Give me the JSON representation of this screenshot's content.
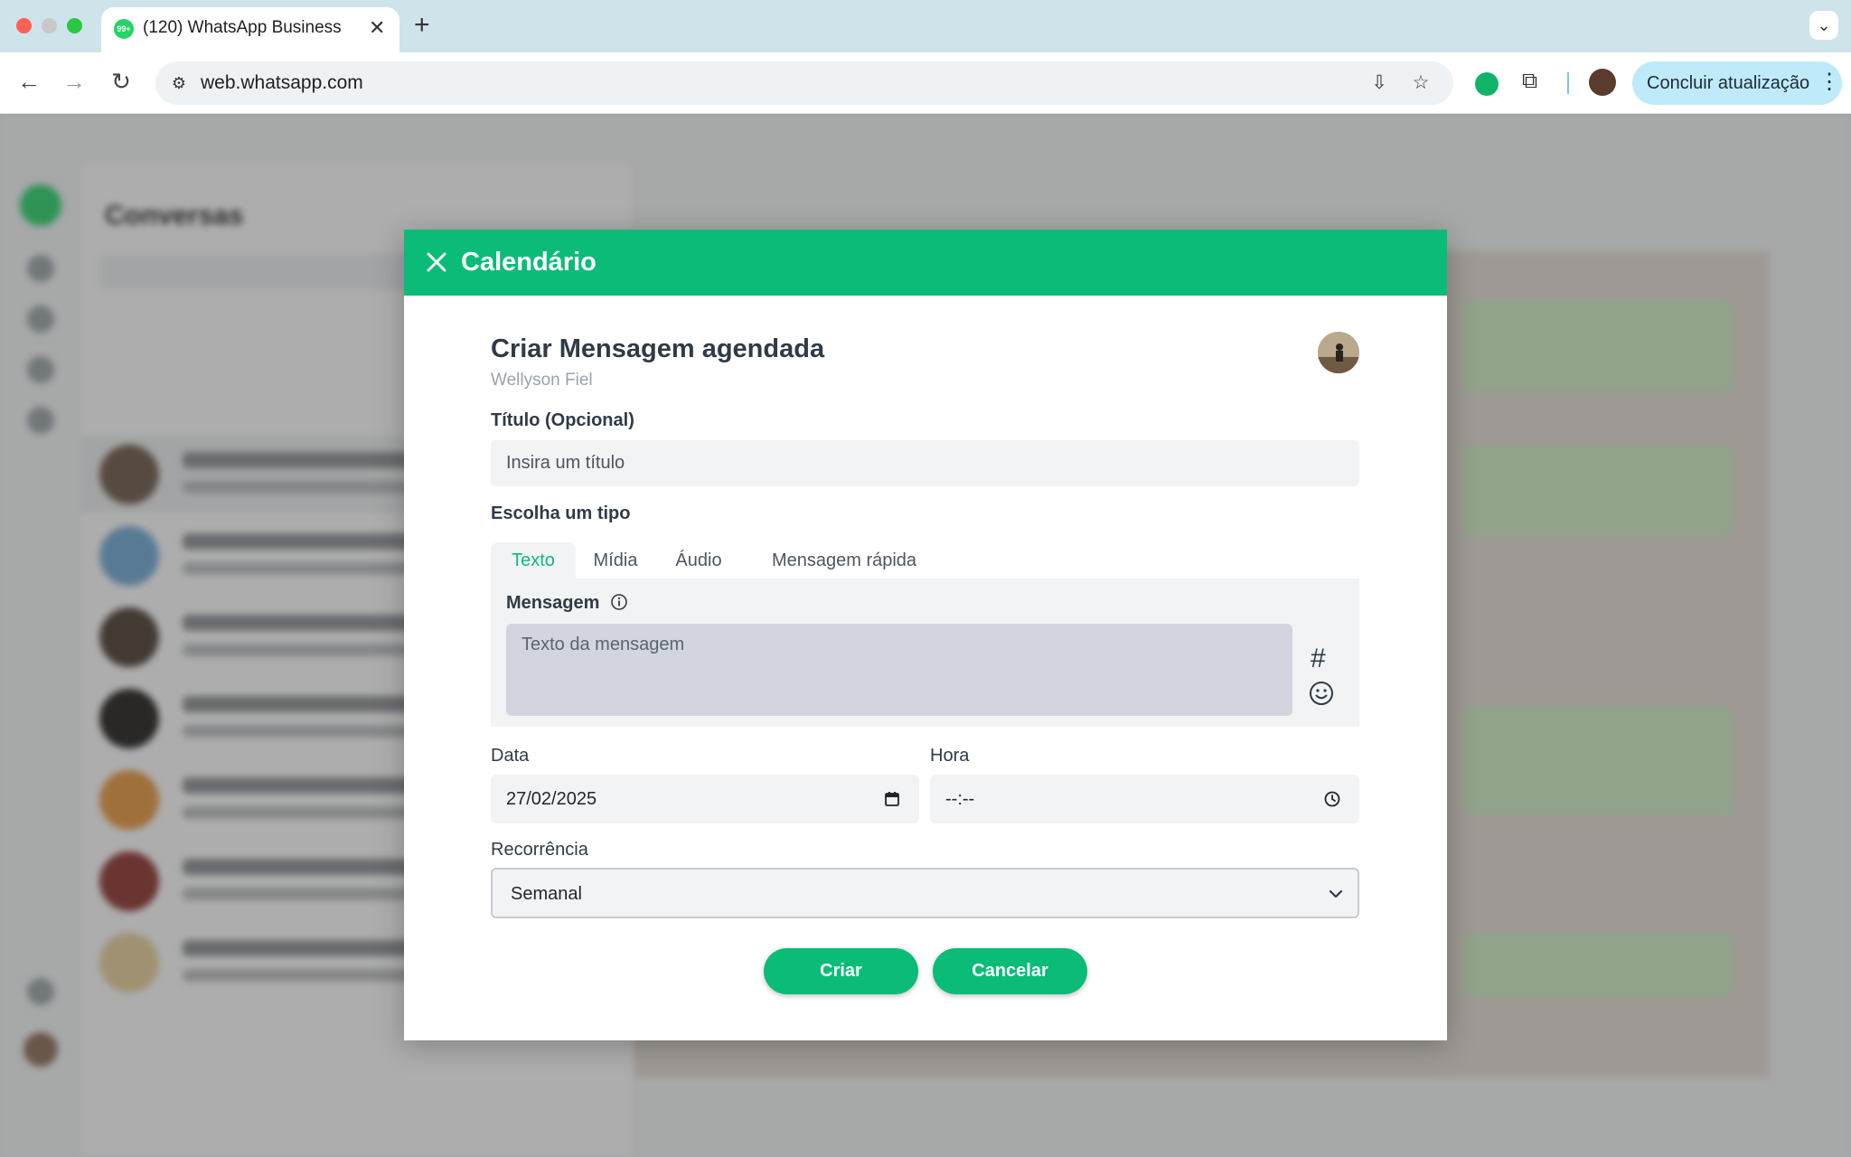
{
  "browser": {
    "tab_title": "(120) WhatsApp Business",
    "tab_badge": "99+",
    "url": "web.whatsapp.com",
    "update_button": "Concluir atualização"
  },
  "modal": {
    "header_title": "Calendário",
    "form_title": "Criar Mensagem agendada",
    "contact_name": "Wellyson Fiel",
    "title_label": "Título (Opcional)",
    "title_placeholder": "Insira um título",
    "type_label": "Escolha um tipo",
    "tabs": [
      {
        "label": "Texto",
        "active": true
      },
      {
        "label": "Mídia",
        "active": false
      },
      {
        "label": "Áudio",
        "active": false
      },
      {
        "label": "Mensagem rápida",
        "active": false
      }
    ],
    "message_label": "Mensagem",
    "message_placeholder": "Texto da mensagem",
    "hash_symbol": "#",
    "date_label": "Data",
    "date_value": "27/02/2025",
    "time_label": "Hora",
    "time_value": "--:--",
    "recurrence_label": "Recorrência",
    "recurrence_value": "Semanal",
    "create_button": "Criar",
    "cancel_button": "Cancelar"
  },
  "colors": {
    "accent": "#0bbc78",
    "panel": "#f2f3f5",
    "text": "#2f3b47"
  },
  "icons": {
    "close": "close-icon",
    "info": "info-icon",
    "hash": "hashtag-icon",
    "emoji": "emoji-icon",
    "calendar": "calendar-icon",
    "clock": "clock-icon",
    "chevron": "chevron-down-icon"
  }
}
